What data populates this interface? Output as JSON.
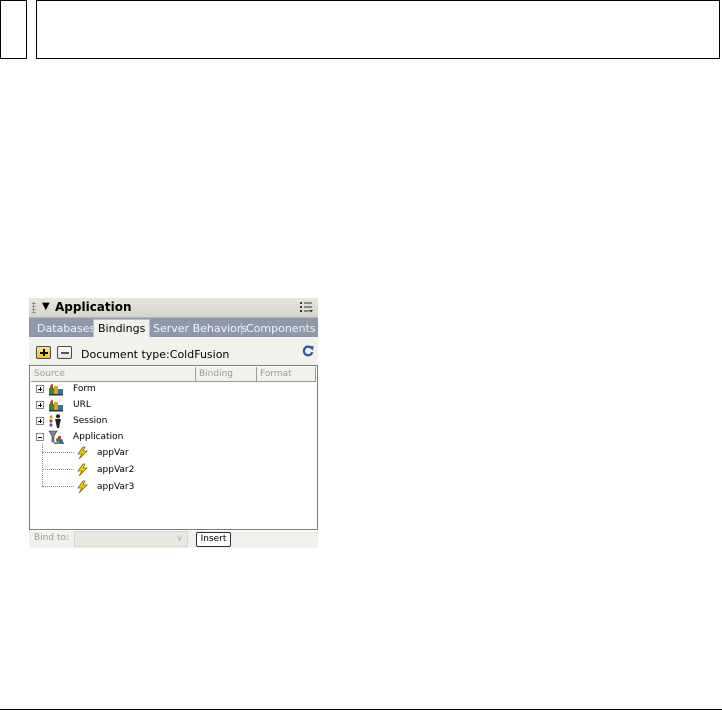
{
  "panel": {
    "title": "Application",
    "tabs": [
      "Databases",
      "Bindings",
      "Server Behaviors",
      "Components"
    ],
    "active_tab": "Bindings",
    "toolbar": {
      "document_type": "Document type:ColdFusion"
    },
    "columns": [
      "Source",
      "Binding",
      "Format"
    ],
    "tree": {
      "form": "Form",
      "url": "URL",
      "session": "Session",
      "application": "Application",
      "children": [
        "appVar",
        "appVar2",
        "appVar3"
      ]
    },
    "bindbar": {
      "bind_to_label": "Bind to:",
      "insert_label": "Insert"
    }
  }
}
